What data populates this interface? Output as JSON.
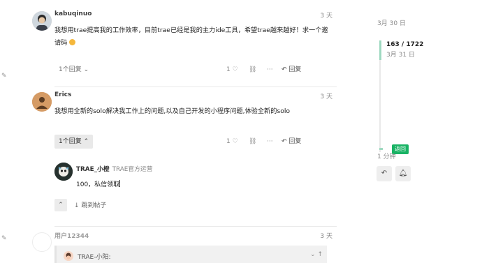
{
  "posts": [
    {
      "username": "kabuqinuo",
      "date": "3 天",
      "text": "我想用trae提高我的工作效率，目前trae已经是我的主力ide工具，希望trae越来越好！求一个邀请码",
      "replies_label": "1个回复",
      "likes": "1",
      "reply_label": "回复"
    },
    {
      "username": "Erics",
      "date": "3 天",
      "text": "我想用全新的solo解决我工作上的问题,以及自己开发的小程序问题,体验全新的solo",
      "replies_label": "1个回复",
      "likes": "1",
      "reply_label": "回复"
    },
    {
      "username": "用户12344",
      "date": "3 天"
    }
  ],
  "embedded_reply": {
    "username": "TRAE_小橙",
    "title": "TRAE官方运营",
    "text": "100，私信领取",
    "jump_label": "跳到帖子"
  },
  "quote": {
    "name": "TRAE-小阳:"
  },
  "timeline": {
    "start_date": "3月 30 日",
    "position": "163 / 1722",
    "position_date": "3月 31 日",
    "back_label": "返回",
    "end_label": "1 分钟"
  },
  "icons": {
    "heart": "heart-icon",
    "link": "link-icon",
    "more": "ellipsis-icon",
    "reply": "reply-arrow-icon",
    "chevron": "chevron-icon",
    "bell": "bell-icon",
    "pencil": "pencil-icon"
  },
  "colors": {
    "accent_green": "#18b364",
    "timeline_handle": "#9ed9c0"
  }
}
